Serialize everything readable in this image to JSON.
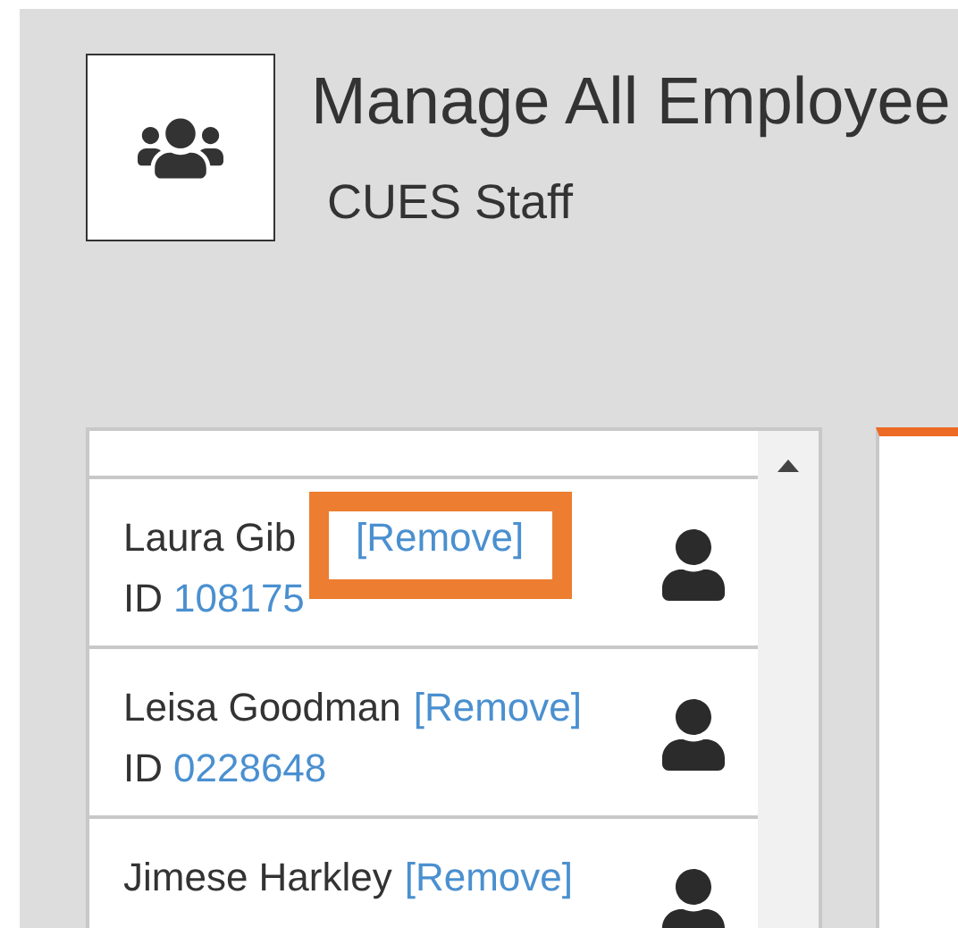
{
  "header": {
    "title": "Manage All Employee",
    "subtitle": "CUES Staff"
  },
  "employees": [
    {
      "name": "Laura Gib",
      "id_label": "ID",
      "id": "108175",
      "remove": "[Remove]"
    },
    {
      "name": "Leisa Goodman",
      "id_label": "ID",
      "id": "0228648",
      "remove": "[Remove]"
    },
    {
      "name": "Jimese Harkley",
      "remove": "[Remove]"
    }
  ]
}
